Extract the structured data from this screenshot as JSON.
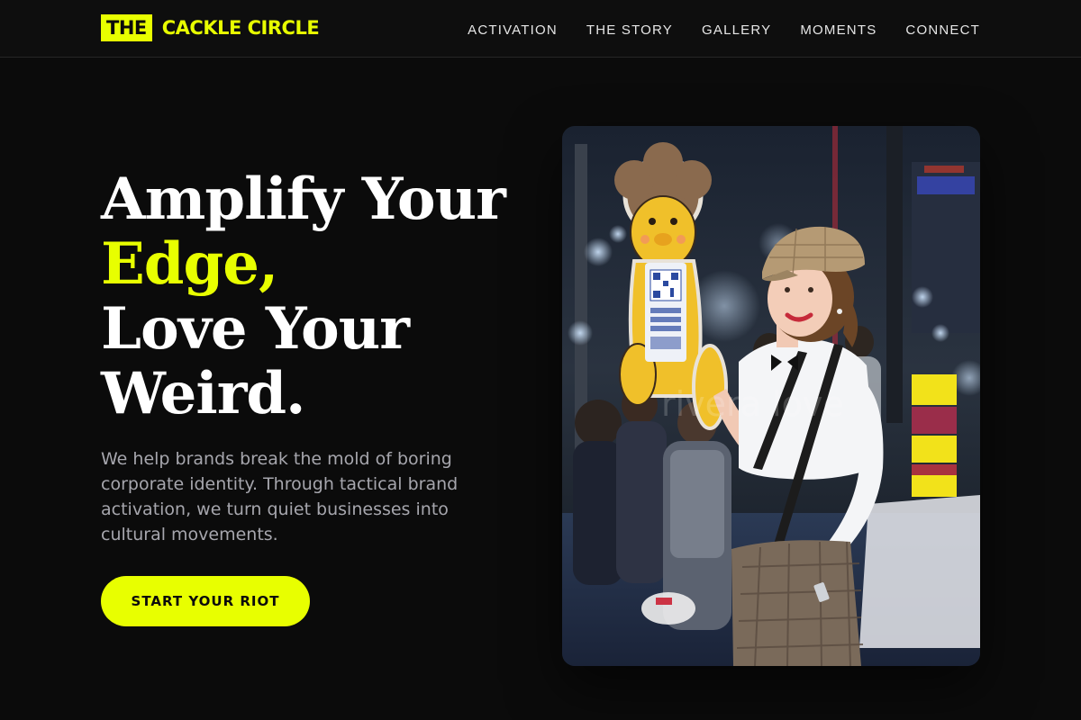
{
  "brand": {
    "logo_box": "THE",
    "logo_text": "CACKLE CIRCLE",
    "accent_color": "#e8ff00"
  },
  "nav": {
    "items": [
      {
        "label": "ACTIVATION"
      },
      {
        "label": "THE STORY"
      },
      {
        "label": "GALLERY"
      },
      {
        "label": "MOMENTS"
      },
      {
        "label": "CONNECT"
      }
    ]
  },
  "hero": {
    "title_line1": "Amplify Your",
    "title_line2_accent": "Edge,",
    "title_line3": "Love Your",
    "title_line4": "Weird.",
    "subtitle": "We help brands break the mold of boring corporate identity. Through tactical brand activation, we turn quiet businesses into cultural movements.",
    "cta_label": "START YOUR RIOT",
    "image_icon": "promo-photo-woman-with-mascot-sign"
  }
}
